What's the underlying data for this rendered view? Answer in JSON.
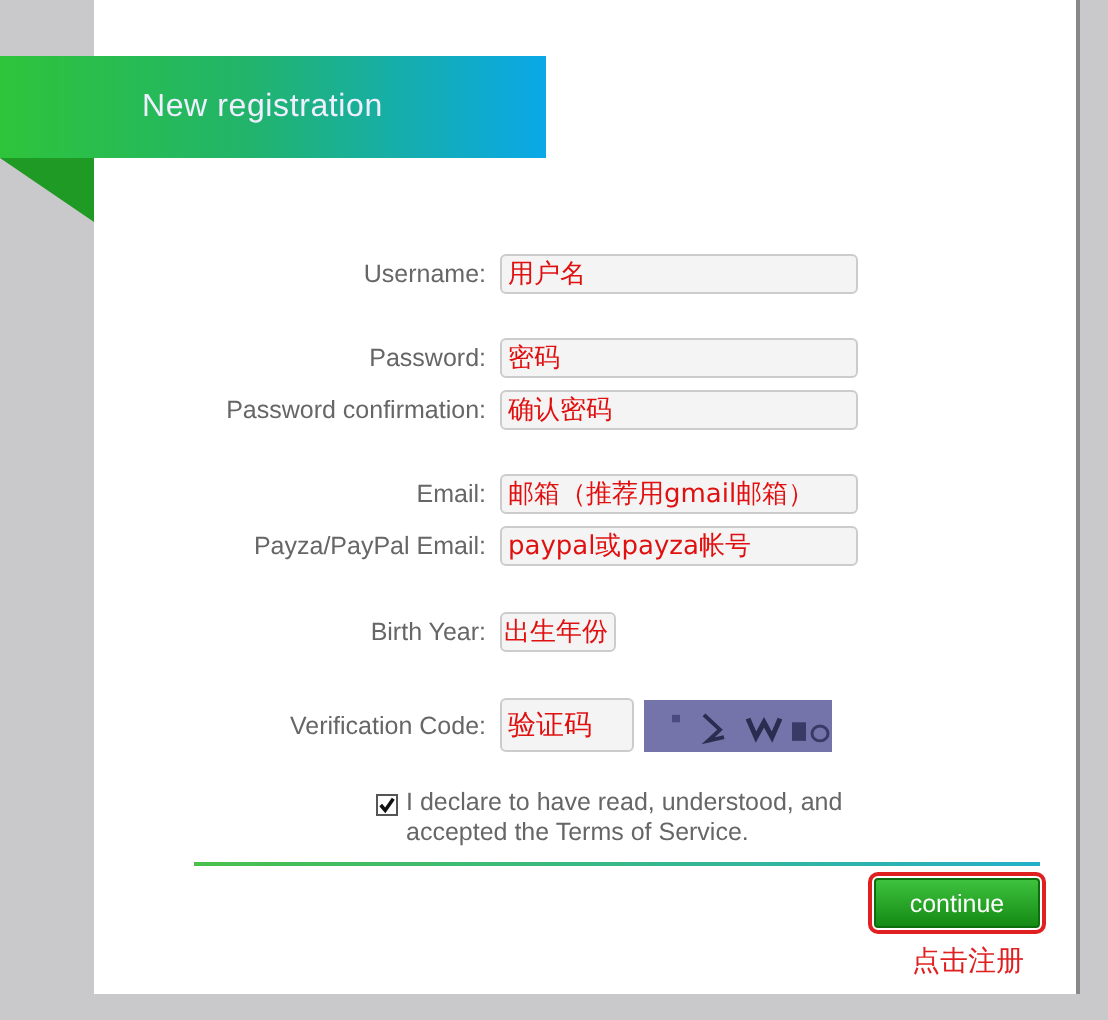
{
  "header": {
    "title": "New registration"
  },
  "groups": [
    {
      "fields": [
        {
          "label": "Username:",
          "value": "用户名",
          "kind": "wide"
        }
      ]
    },
    {
      "fields": [
        {
          "label": "Password:",
          "value": "密码",
          "kind": "wide"
        },
        {
          "label": "Password confirmation:",
          "value": "确认密码",
          "kind": "wide"
        }
      ]
    },
    {
      "fields": [
        {
          "label": "Email:",
          "value": "邮箱（推荐用gmail邮箱）",
          "kind": "wide"
        },
        {
          "label": "Payza/PayPal Email:",
          "value": "paypal或payza帐号",
          "kind": "wide"
        }
      ]
    },
    {
      "fields": [
        {
          "label": "Birth Year:",
          "value": "出生年份",
          "kind": "short"
        }
      ]
    },
    {
      "fields": [
        {
          "label": "Verification Code:",
          "value": "验证码",
          "kind": "captcha"
        }
      ]
    }
  ],
  "terms": {
    "text": "I declare to have read, understood, and accepted the Terms of Service.",
    "checked": true
  },
  "continue_button": {
    "label": "continue"
  },
  "note": "点击注册"
}
